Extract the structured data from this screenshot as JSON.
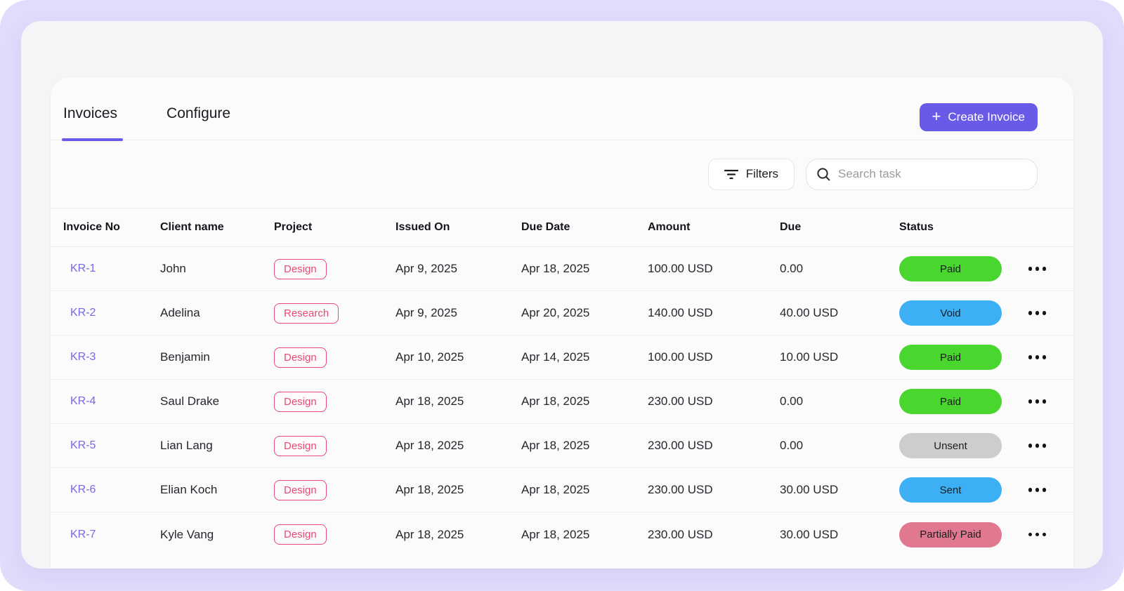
{
  "tabs": [
    {
      "label": "Invoices",
      "active": true
    },
    {
      "label": "Configure",
      "active": false
    }
  ],
  "toolbar": {
    "create_invoice_label": "Create Invoice",
    "filters_label": "Filters",
    "search_placeholder": "Search task"
  },
  "table": {
    "columns": [
      "Invoice No",
      "Client name",
      "Project",
      "Issued On",
      "Due Date",
      "Amount",
      "Due",
      "Status"
    ],
    "rows": [
      {
        "invoice_no": "KR-1",
        "client": "John",
        "project": "Design",
        "issued_on": "Apr 9, 2025",
        "due_date": "Apr 18, 2025",
        "amount": "100.00 USD",
        "due": "0.00",
        "status": "Paid",
        "status_type": "paid"
      },
      {
        "invoice_no": "KR-2",
        "client": "Adelina",
        "project": "Research",
        "issued_on": "Apr 9, 2025",
        "due_date": "Apr 20, 2025",
        "amount": "140.00 USD",
        "due": "40.00 USD",
        "status": "Void",
        "status_type": "void"
      },
      {
        "invoice_no": "KR-3",
        "client": "Benjamin",
        "project": "Design",
        "issued_on": "Apr 10, 2025",
        "due_date": "Apr 14, 2025",
        "amount": "100.00 USD",
        "due": "10.00 USD",
        "status": "Paid",
        "status_type": "paid"
      },
      {
        "invoice_no": "KR-4",
        "client": "Saul Drake",
        "project": "Design",
        "issued_on": "Apr 18, 2025",
        "due_date": "Apr 18, 2025",
        "amount": "230.00 USD",
        "due": "0.00",
        "status": "Paid",
        "status_type": "paid"
      },
      {
        "invoice_no": "KR-5",
        "client": "Lian Lang",
        "project": "Design",
        "issued_on": "Apr 18, 2025",
        "due_date": "Apr 18, 2025",
        "amount": "230.00 USD",
        "due": "0.00",
        "status": "Unsent",
        "status_type": "unsent"
      },
      {
        "invoice_no": "KR-6",
        "client": "Elian Koch",
        "project": "Design",
        "issued_on": "Apr 18, 2025",
        "due_date": "Apr 18, 2025",
        "amount": "230.00 USD",
        "due": "30.00 USD",
        "status": "Sent",
        "status_type": "sent"
      },
      {
        "invoice_no": "KR-7",
        "client": "Kyle Vang",
        "project": "Design",
        "issued_on": "Apr 18, 2025",
        "due_date": "Apr 18, 2025",
        "amount": "230.00 USD",
        "due": "30.00 USD",
        "status": "Partially Paid",
        "status_type": "partially_paid"
      }
    ]
  },
  "colors": {
    "accent": "#6A5AE8",
    "background": "#E1DCFC",
    "card": "#F5F4F6",
    "panel": "#FBFBFC",
    "link": "#7668E6",
    "project_badge": "#E94A73",
    "status_paid": "#49D62E",
    "status_void": "#3DAFF5",
    "status_sent": "#3DAFF5",
    "status_unsent": "#CDCDCF",
    "status_partially_paid": "#E0798F"
  },
  "icons": {
    "plus": "+",
    "filter": "filter-lines-icon",
    "search": "magnifier-icon",
    "row_menu": "ellipsis-icon"
  }
}
